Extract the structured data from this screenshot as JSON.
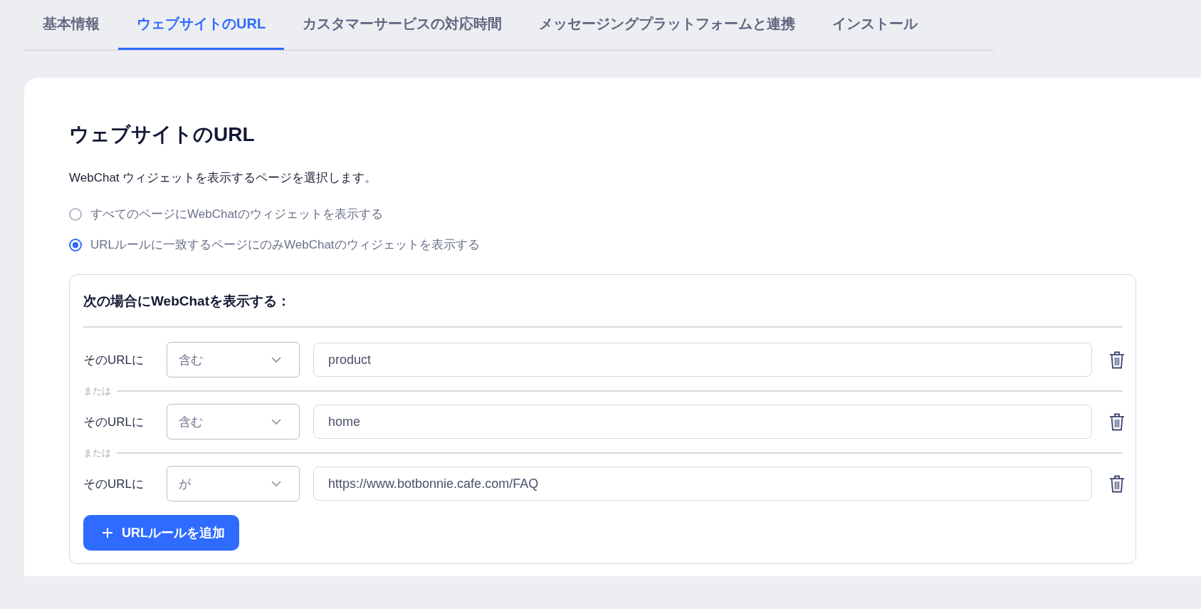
{
  "tabs": [
    {
      "label": "基本情報",
      "selected": false
    },
    {
      "label": "ウェブサイトのURL",
      "selected": true
    },
    {
      "label": "カスタマーサービスの対応時間",
      "selected": false
    },
    {
      "label": "メッセージングプラットフォームと連携",
      "selected": false
    },
    {
      "label": "インストール",
      "selected": false
    }
  ],
  "section": {
    "title": "ウェブサイトのURL",
    "description": "WebChat ウィジェットを表示するページを選択します。",
    "options": [
      {
        "label": "すべてのページにWebChatのウィジェットを表示する",
        "selected": false
      },
      {
        "label": "URLルールに一致するページにのみWebChatのウィジェットを表示する",
        "selected": true
      }
    ],
    "rules": {
      "title": "次の場合にWebChatを表示する：",
      "rows": [
        {
          "label": "そのURLに",
          "operator": "含む",
          "value": "product"
        },
        {
          "separator": "または",
          "label": "そのURLに",
          "operator": "含む",
          "value": "home"
        },
        {
          "separator": "または",
          "label": "そのURLに",
          "operator": "が",
          "value": "https://www.botbonnie.cafe.com/FAQ"
        }
      ],
      "add_button": "URLルールを追加"
    }
  }
}
